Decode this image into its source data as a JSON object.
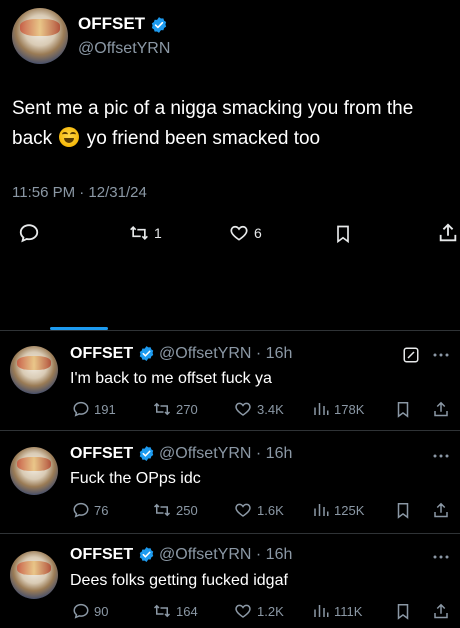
{
  "main_tweet": {
    "author_name": "OFFSET",
    "author_handle": "@OffsetYRN",
    "text_before_emoji": "Sent me a pic of a nigga smacking you from the back",
    "emoji": "sweat-smile-emoji",
    "text_after_emoji": "yo friend been smacked too",
    "timestamp": "11:56 PM · 12/31/24",
    "retweets": "1",
    "likes": "6"
  },
  "replies": [
    {
      "author_name": "OFFSET",
      "author_handle": "@OffsetYRN",
      "time": "· 16h",
      "text": "I'm back to me offset fuck ya",
      "replies": "191",
      "retweets": "270",
      "likes": "3.4K",
      "views": "178K",
      "has_grok_icon": true
    },
    {
      "author_name": "OFFSET",
      "author_handle": "@OffsetYRN",
      "time": "· 16h",
      "text": "Fuck the OPps idc",
      "replies": "76",
      "retweets": "250",
      "likes": "1.6K",
      "views": "125K"
    },
    {
      "author_name": "OFFSET",
      "author_handle": "@OffsetYRN",
      "time": "· 16h",
      "text": "Dees folks getting fucked idgaf",
      "replies": "90",
      "retweets": "164",
      "likes": "1.2K",
      "views": "111K"
    }
  ],
  "colors": {
    "background": "#000000",
    "text": "#e7e9ea",
    "muted": "#8b98a5",
    "verified_blue": "#1d9bf0"
  }
}
